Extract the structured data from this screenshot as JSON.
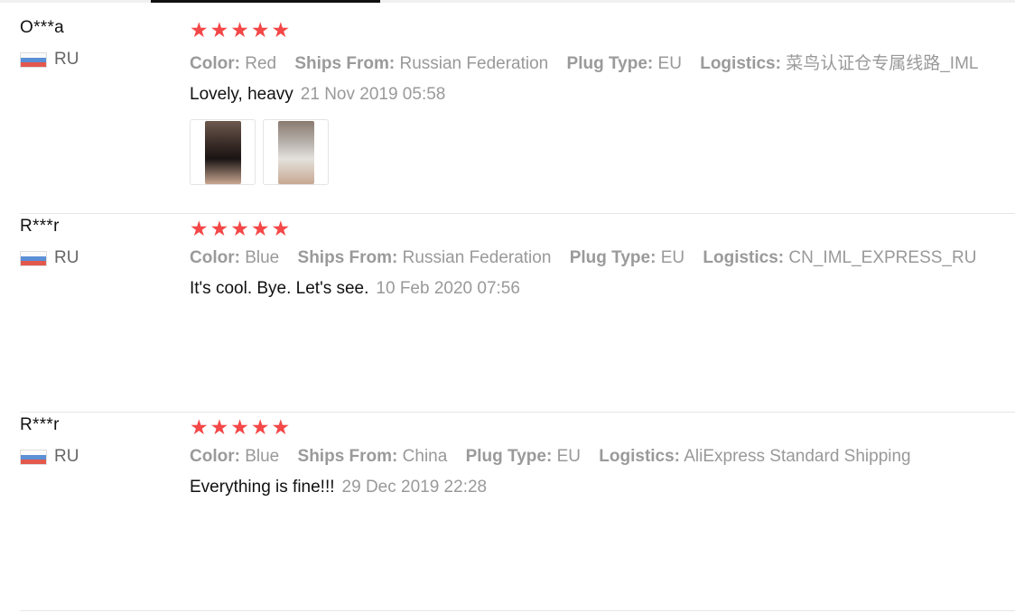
{
  "reviews": [
    {
      "user": "O***a",
      "country": "RU",
      "rating_stars": 5,
      "stars": "★★★★★",
      "attributes": [
        {
          "label": "Color:",
          "value": "Red"
        },
        {
          "label": "Ships From:",
          "value": "Russian Federation"
        },
        {
          "label": "Plug Type:",
          "value": "EU"
        },
        {
          "label": "Logistics:",
          "value": "菜鸟认证仓专属线路_IML"
        }
      ],
      "text": "Lovely, heavy",
      "date": "21 Nov 2019 05:58",
      "photos": [
        "dark iron photo",
        "white iron photo"
      ]
    },
    {
      "user": "R***r",
      "country": "RU",
      "rating_stars": 5,
      "stars": "★★★★★",
      "attributes": [
        {
          "label": "Color:",
          "value": "Blue"
        },
        {
          "label": "Ships From:",
          "value": "Russian Federation"
        },
        {
          "label": "Plug Type:",
          "value": "EU"
        },
        {
          "label": "Logistics:",
          "value": "CN_IML_EXPRESS_RU"
        }
      ],
      "text": "It's cool. Bye. Let's see.",
      "date": "10 Feb 2020 07:56"
    },
    {
      "user": "R***r",
      "country": "RU",
      "rating_stars": 5,
      "stars": "★★★★★",
      "attributes": [
        {
          "label": "Color:",
          "value": "Blue"
        },
        {
          "label": "Ships From:",
          "value": "China"
        },
        {
          "label": "Plug Type:",
          "value": "EU"
        },
        {
          "label": "Logistics:",
          "value": "AliExpress Standard Shipping"
        }
      ],
      "text": "Everything is fine!!!",
      "date": "29 Dec 2019 22:28"
    }
  ],
  "colors": {
    "star": "#f44747",
    "muted_text": "#999999",
    "divider": "#e6e6e6",
    "active_tab": "#111111"
  }
}
